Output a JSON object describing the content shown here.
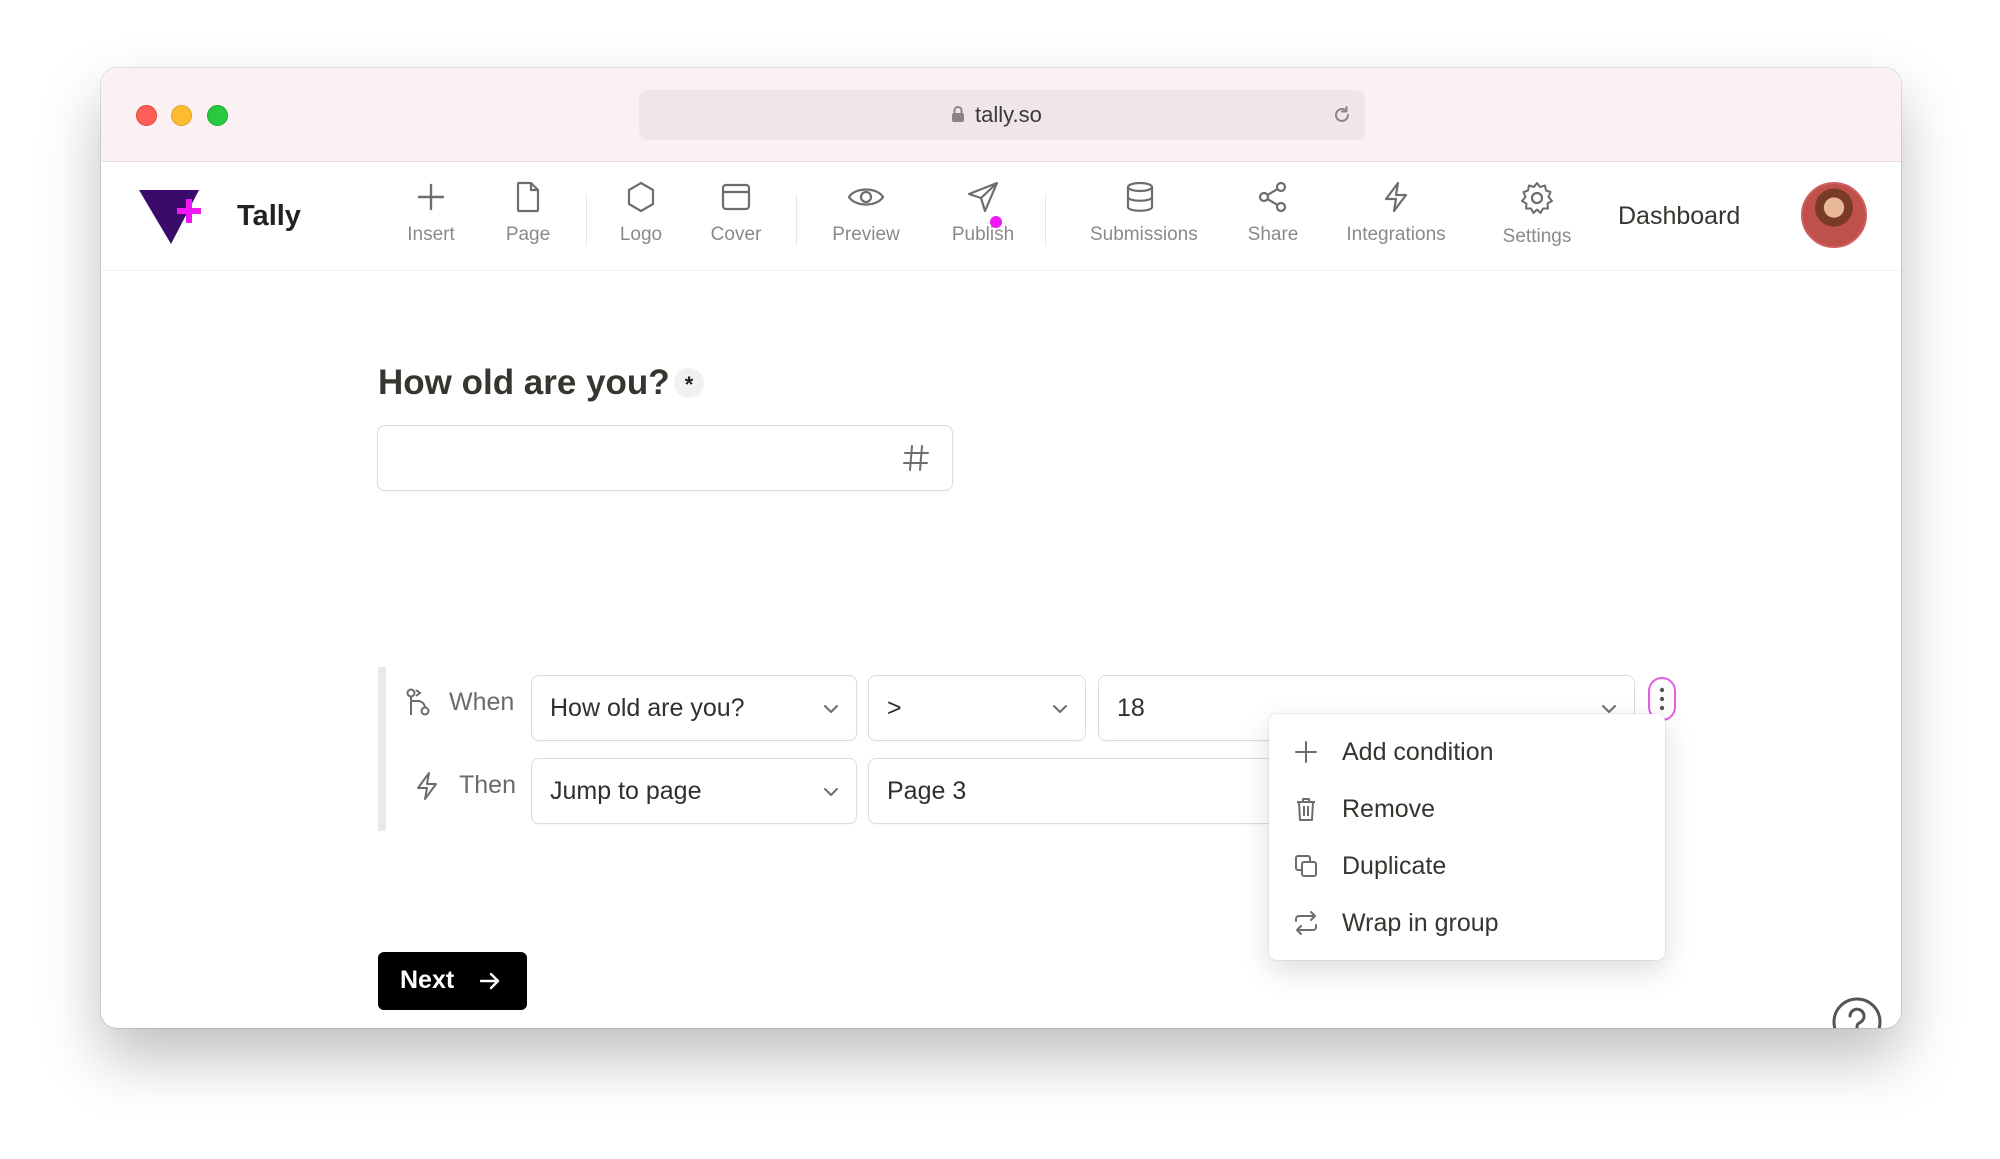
{
  "browser": {
    "url": "tally.so"
  },
  "toolbar": {
    "brand": "Tally",
    "items": [
      {
        "label": "Insert",
        "icon": "plus-icon"
      },
      {
        "label": "Page",
        "icon": "page-icon"
      },
      {
        "label": "Logo",
        "icon": "hexagon-icon"
      },
      {
        "label": "Cover",
        "icon": "cover-icon"
      },
      {
        "label": "Preview",
        "icon": "eye-icon"
      },
      {
        "label": "Publish",
        "icon": "send-icon"
      },
      {
        "label": "Submissions",
        "icon": "database-icon"
      },
      {
        "label": "Share",
        "icon": "share-icon"
      },
      {
        "label": "Integrations",
        "icon": "lightning-icon"
      },
      {
        "label": "Settings",
        "icon": "gear-icon"
      }
    ],
    "dashboard": "Dashboard"
  },
  "form": {
    "question": "How old are you?",
    "required_mark": "*"
  },
  "logic": {
    "when_label": "When",
    "then_label": "Then",
    "when_field": "How old are you?",
    "operator": ">",
    "value": "18",
    "action": "Jump to page",
    "target": "Page 3"
  },
  "menu": {
    "items": [
      {
        "label": "Add condition",
        "icon": "plus-icon"
      },
      {
        "label": "Remove",
        "icon": "trash-icon"
      },
      {
        "label": "Duplicate",
        "icon": "copy-icon"
      },
      {
        "label": "Wrap in group",
        "icon": "repeat-icon"
      }
    ]
  },
  "next_button": {
    "label": "Next"
  },
  "colors": {
    "accent_pink": "#f118f5",
    "brand_purple": "#3a0b6b",
    "titlebar": "#fcf1f2"
  }
}
